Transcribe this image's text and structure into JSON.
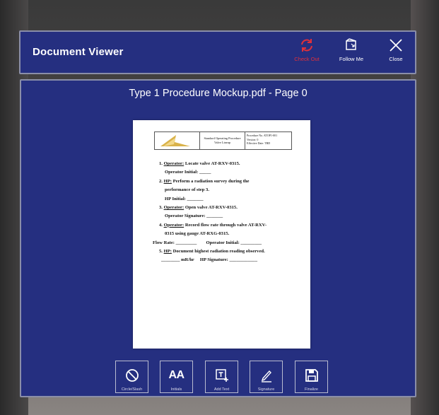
{
  "header": {
    "title": "Document Viewer",
    "buttons": [
      {
        "label": "Check Out",
        "icon": "sync-icon"
      },
      {
        "label": "Follow Me",
        "icon": "follow-me-icon"
      },
      {
        "label": "Close",
        "icon": "close-icon"
      }
    ]
  },
  "viewer": {
    "document_title": "Type 1 Procedure Mockup.pdf - Page 0"
  },
  "page": {
    "header_middle": [
      "Standard Operating Procedure",
      "Valve Lineup"
    ],
    "header_right": [
      "Procedure No. ATOP1-001",
      "Version: 0",
      "Effective Date: TBD"
    ],
    "steps": [
      {
        "num": "1.",
        "role": "Operator:",
        "text": " Locate valve AT-RXV-0315."
      },
      {
        "line": "Operator Initial: _____"
      },
      {
        "num": "2.",
        "role": "HP:",
        "text": " Perform a radiation survey during the"
      },
      {
        "line": "performance of step 3."
      },
      {
        "line": "HP Initial: _______"
      },
      {
        "num": "3.",
        "role": "Operator:",
        "text": " Open valve AT-RXV-0315."
      },
      {
        "line": "Operator Signature: _______"
      },
      {
        "num": "4.",
        "role": "Operator:",
        "text": " Record flow rate through valve AT-RXV-"
      },
      {
        "line": "0315 using gauge AT-RXG-0315."
      },
      {
        "flow": "Flow Rate: _________        Operator Initial: _________"
      },
      {
        "num": "5.",
        "role": "HP:",
        "text": " Document highest radiation reading observed."
      },
      {
        "line": "________ mR/hr     HP Signature: ____________"
      }
    ]
  },
  "toolbar": {
    "buttons": [
      {
        "label": "Circle/Slash",
        "icon": "circle-slash-icon"
      },
      {
        "label": "Initials",
        "icon": "initials-icon",
        "glyph": "AA"
      },
      {
        "label": "Add Text",
        "icon": "add-text-icon"
      },
      {
        "label": "Signature",
        "icon": "signature-icon"
      },
      {
        "label": "Finalize",
        "icon": "save-icon"
      }
    ]
  },
  "colors": {
    "panel": "#252f80",
    "accent_red": "#e0303a"
  }
}
